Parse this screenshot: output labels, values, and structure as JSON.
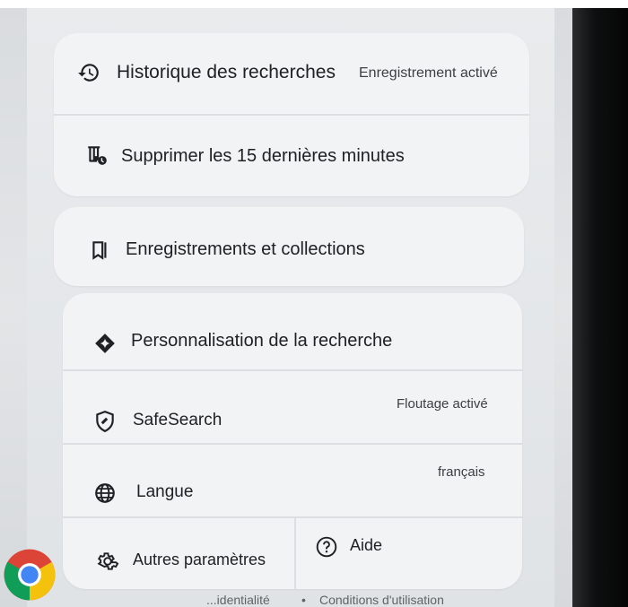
{
  "menu": {
    "search_history": {
      "label": "Historique des recherches",
      "status": "Enregistrement activé",
      "icon": "history-icon"
    },
    "delete_recent": {
      "label": "Supprimer les 15 dernières minutes",
      "icon": "delete-history-icon"
    },
    "saves": {
      "label": "Enregistrements et collections",
      "icon": "bookmark-icon"
    },
    "personalization": {
      "label": "Personnalisation de la recherche",
      "icon": "sparkle-icon"
    },
    "safesearch": {
      "label": "SafeSearch",
      "status": "Floutage activé",
      "icon": "safesearch-shield-icon"
    },
    "language": {
      "label": "Langue",
      "status": "français",
      "icon": "globe-icon"
    },
    "more_settings": {
      "label": "Autres paramètres",
      "icon": "gear-icon"
    },
    "help": {
      "label": "Aide",
      "icon": "help-circle-icon"
    }
  },
  "footer": {
    "privacy": "...identialité",
    "separator": "•",
    "terms": "Conditions d'utilisation"
  },
  "colors": {
    "card": "#f2f3f4",
    "text": "#202124",
    "muted": "#5f6368"
  }
}
